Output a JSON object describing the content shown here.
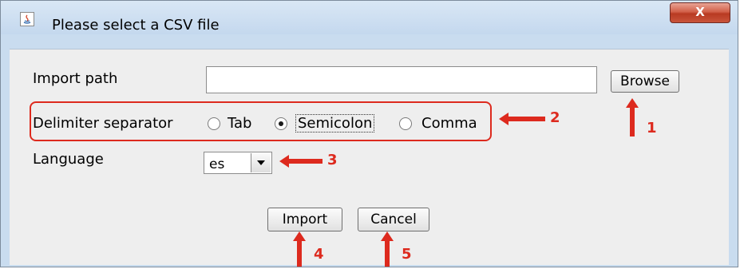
{
  "window": {
    "title": "Please select a CSV file",
    "close_label": "X"
  },
  "form": {
    "import_path_label": "Import path",
    "import_path_value": "",
    "browse_label": "Browse",
    "delimiter_label": "Delimiter separator",
    "delimiter_options": [
      {
        "label": "Tab",
        "selected": false
      },
      {
        "label": "Semicolon",
        "selected": true
      },
      {
        "label": "Comma",
        "selected": false
      }
    ],
    "language_label": "Language",
    "language_value": "es",
    "import_label": "Import",
    "cancel_label": "Cancel"
  },
  "annotations": {
    "marker_1": "1",
    "marker_2": "2",
    "marker_3": "3",
    "marker_4": "4",
    "marker_5": "5",
    "color": "#dd2a1e"
  }
}
